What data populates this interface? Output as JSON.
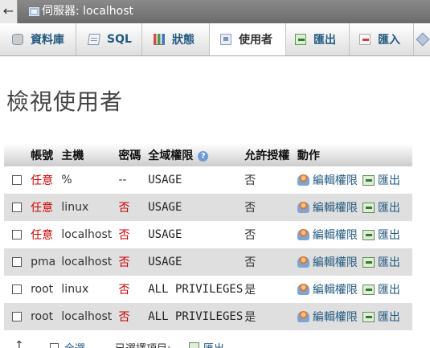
{
  "topbar": {
    "back_label": "←",
    "server_label": "伺服器: localhost"
  },
  "tabs": [
    {
      "label": "資料庫"
    },
    {
      "label": "SQL"
    },
    {
      "label": "狀態"
    },
    {
      "label": "使用者"
    },
    {
      "label": "匯出"
    },
    {
      "label": "匯入"
    }
  ],
  "page_title": "檢視使用者",
  "table": {
    "headers": {
      "user": "帳號",
      "host": "主機",
      "password": "密碼",
      "global_privileges": "全域權限",
      "grant": "允許授權",
      "action": "動作"
    },
    "help_mark": "?",
    "rows": [
      {
        "user": "任意",
        "host": "%",
        "password": "--",
        "privileges": "USAGE",
        "grant": "否",
        "edit": "編輯權限",
        "export": "匯出"
      },
      {
        "user": "任意",
        "host": "linux",
        "password": "否",
        "privileges": "USAGE",
        "grant": "否",
        "edit": "編輯權限",
        "export": "匯出"
      },
      {
        "user": "任意",
        "host": "localhost",
        "password": "否",
        "privileges": "USAGE",
        "grant": "否",
        "edit": "編輯權限",
        "export": "匯出"
      },
      {
        "user": "pma",
        "host": "localhost",
        "password": "否",
        "privileges": "USAGE",
        "grant": "否",
        "edit": "編輯權限",
        "export": "匯出"
      },
      {
        "user": "root",
        "host": "linux",
        "password": "否",
        "privileges": "ALL PRIVILEGES",
        "grant": "是",
        "edit": "編輯權限",
        "export": "匯出"
      },
      {
        "user": "root",
        "host": "localhost",
        "password": "否",
        "privileges": "ALL PRIVILEGES",
        "grant": "是",
        "edit": "編輯權限",
        "export": "匯出"
      }
    ]
  },
  "footer": {
    "arrow": "↑",
    "check_all": "全選",
    "with_selected": "已選擇項目:",
    "export": "匯出"
  }
}
